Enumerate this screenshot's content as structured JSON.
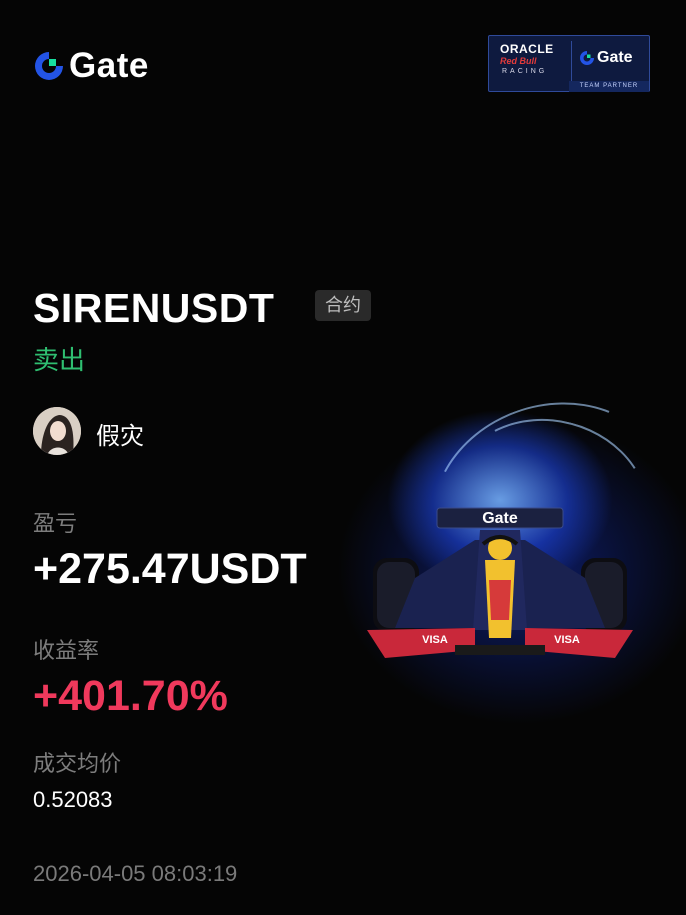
{
  "brand": {
    "name": "Gate",
    "partner": {
      "line1": "ORACLE",
      "line2": "Red Bull",
      "line3": "RACING",
      "gate": "Gate",
      "badge": "TEAM PARTNER"
    }
  },
  "trade": {
    "symbol": "SIRENUSDT",
    "type_tag": "合约",
    "side": "卖出",
    "username": "假灾"
  },
  "stats": {
    "pnl_label": "盈亏",
    "pnl_value": "+275.47USDT",
    "roi_label": "收益率",
    "roi_value": "+401.70%",
    "avg_price_label": "成交均价",
    "avg_price_value": "0.52083"
  },
  "timestamp": "2026-04-05 08:03:19",
  "colors": {
    "background": "#050505",
    "sell_green": "#2fbf71",
    "roi_red": "#f0395c",
    "label_gray": "#7d7d7d",
    "brand_blue": "#2354e6"
  },
  "icons": {
    "logo": "gate-logo-icon",
    "avatar": "user-avatar",
    "hero": "f1-race-car-illustration"
  },
  "car_livery": {
    "wing_text": "Gate",
    "side_text": "VISA"
  }
}
